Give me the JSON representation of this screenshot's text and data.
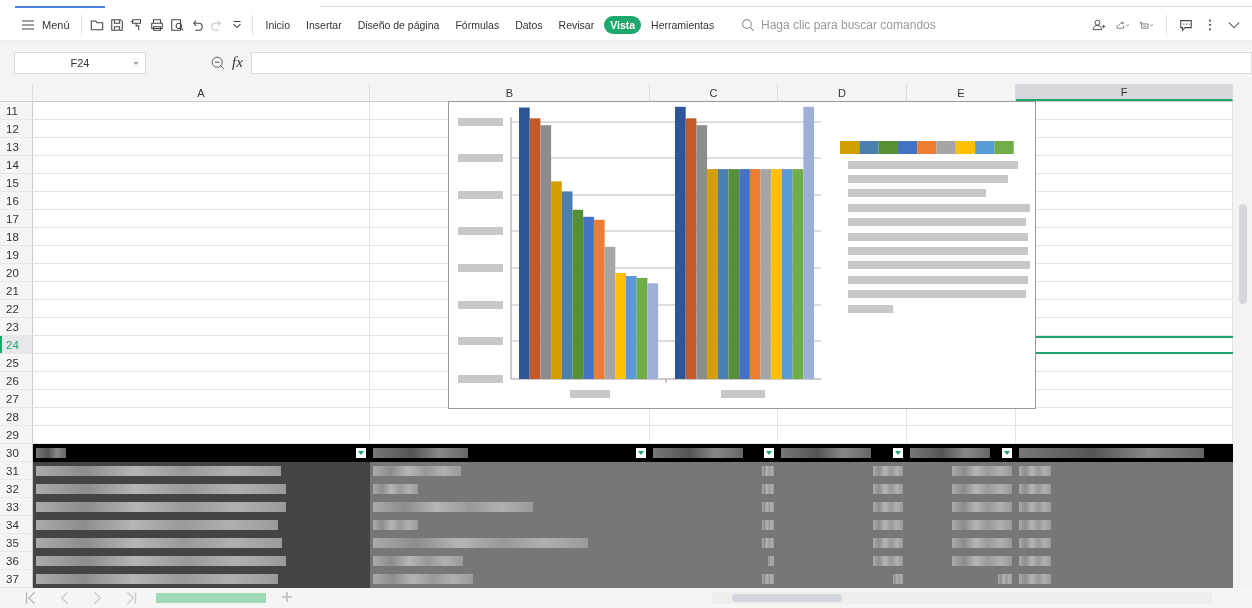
{
  "toolbar": {
    "menu": "Menú",
    "redo": {
      "disabled": true
    },
    "tabs": [
      {
        "label": "Inicio",
        "selected": false
      },
      {
        "label": "Insertar",
        "selected": false
      },
      {
        "label": "Diseño de página",
        "selected": false
      },
      {
        "label": "Fórmulas",
        "selected": false
      },
      {
        "label": "Datos",
        "selected": false
      },
      {
        "label": "Revisar",
        "selected": false
      },
      {
        "label": "Vista",
        "selected": true
      },
      {
        "label": "Herramientas",
        "selected": false
      }
    ],
    "search": {
      "placeholder": "Haga clic para buscar comandos"
    }
  },
  "formula_bar": {
    "name_box": "F24",
    "fx": "fx"
  },
  "sheet": {
    "columns": [
      {
        "label": "A",
        "selected": false
      },
      {
        "label": "B",
        "selected": false
      },
      {
        "label": "C",
        "selected": false
      },
      {
        "label": "D",
        "selected": false
      },
      {
        "label": "E",
        "selected": false
      },
      {
        "label": "F",
        "selected": true
      }
    ],
    "rows": [
      {
        "label": "11",
        "selected": false
      },
      {
        "label": "12",
        "selected": false
      },
      {
        "label": "13",
        "selected": false
      },
      {
        "label": "14",
        "selected": false
      },
      {
        "label": "15",
        "selected": false
      },
      {
        "label": "16",
        "selected": false
      },
      {
        "label": "17",
        "selected": false
      },
      {
        "label": "18",
        "selected": false
      },
      {
        "label": "19",
        "selected": false
      },
      {
        "label": "20",
        "selected": false
      },
      {
        "label": "21",
        "selected": false
      },
      {
        "label": "22",
        "selected": false
      },
      {
        "label": "23",
        "selected": false
      },
      {
        "label": "24",
        "selected": true
      },
      {
        "label": "25",
        "selected": false
      },
      {
        "label": "26",
        "selected": false
      },
      {
        "label": "27",
        "selected": false
      },
      {
        "label": "28",
        "selected": false
      },
      {
        "label": "29",
        "selected": false
      },
      {
        "label": "30",
        "selected": false
      },
      {
        "label": "31",
        "selected": false
      },
      {
        "label": "32",
        "selected": false
      },
      {
        "label": "33",
        "selected": false
      },
      {
        "label": "34",
        "selected": false
      },
      {
        "label": "35",
        "selected": false
      },
      {
        "label": "36",
        "selected": false
      },
      {
        "label": "37",
        "selected": false
      }
    ]
  }
}
